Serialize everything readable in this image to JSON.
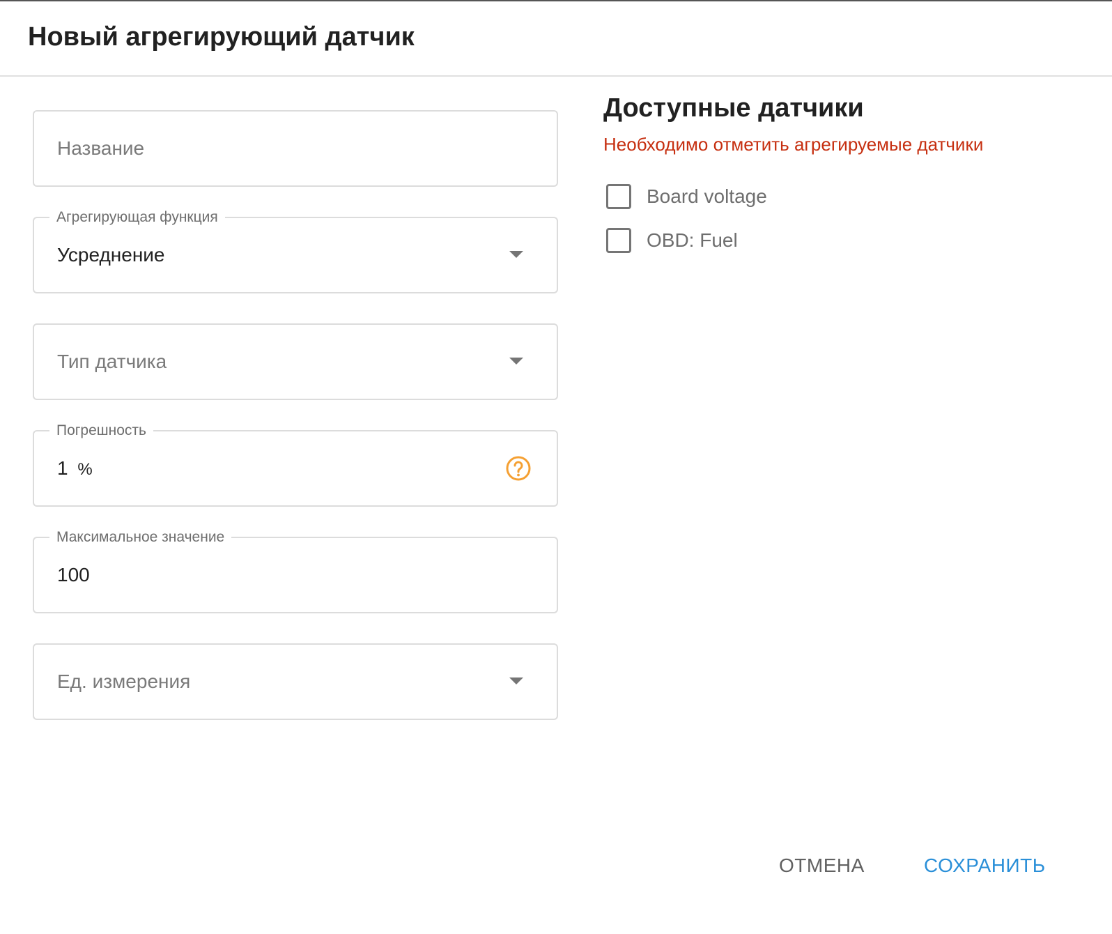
{
  "dialog": {
    "title": "Новый агрегирующий датчик"
  },
  "form": {
    "name": {
      "placeholder": "Название",
      "value": ""
    },
    "aggregate_function": {
      "label": "Агрегирующая функция",
      "value": "Усреднение"
    },
    "sensor_type": {
      "placeholder": "Тип датчика",
      "value": ""
    },
    "accuracy": {
      "label": "Погрешность",
      "value": "1",
      "unit": "%"
    },
    "max_value": {
      "label": "Максимальное значение",
      "value": "100"
    },
    "unit": {
      "placeholder": "Ед. измерения",
      "value": ""
    }
  },
  "available_sensors": {
    "title": "Доступные датчики",
    "error": "Необходимо отметить агрегируемые датчики",
    "items": [
      {
        "label": "Board voltage",
        "checked": false
      },
      {
        "label": "OBD: Fuel",
        "checked": false
      }
    ]
  },
  "actions": {
    "cancel_label": "ОТМЕНА",
    "save_label": "СОХРАНИТЬ"
  },
  "colors": {
    "accent": "#2a8fd8",
    "error": "#c62f10",
    "help_icon": "#f5a032"
  },
  "icons": {
    "dropdown": "chevron-down-icon",
    "help": "help-circle-icon"
  }
}
